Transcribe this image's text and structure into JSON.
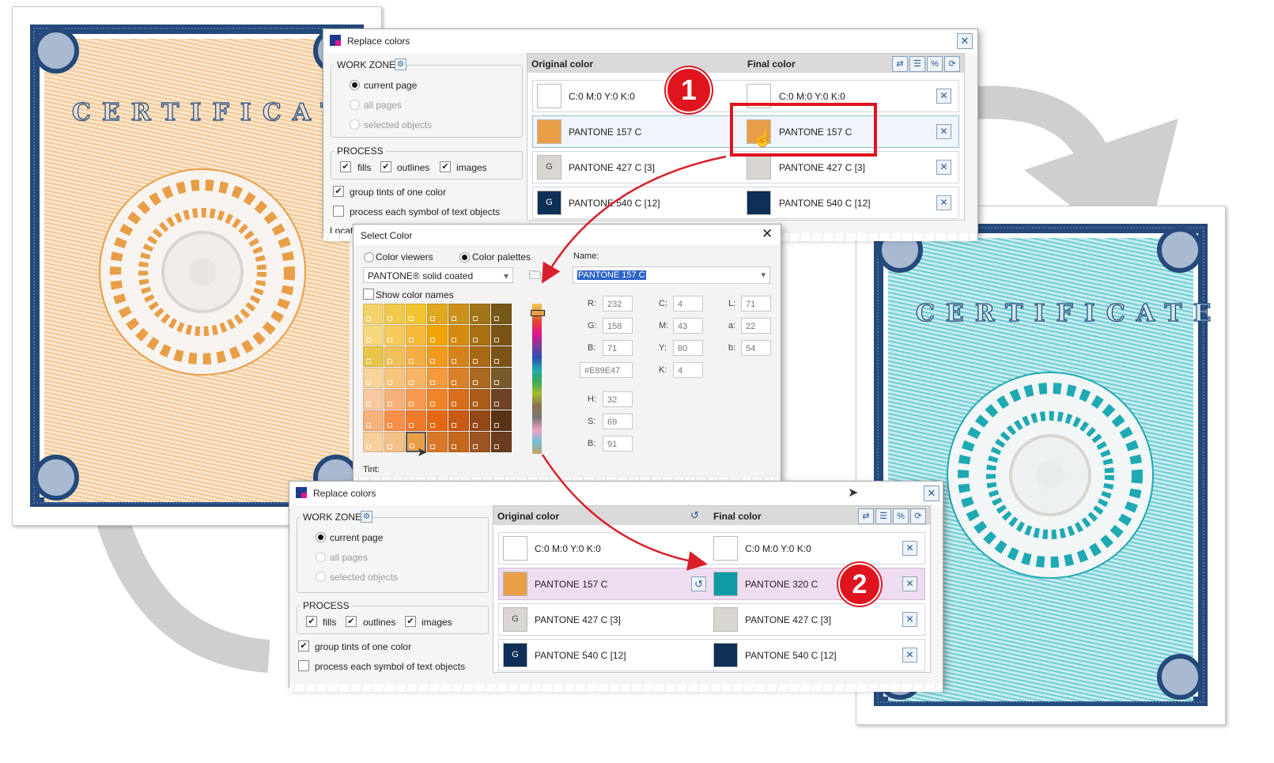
{
  "documents": {
    "left": {
      "title": "CERTIFICATE",
      "accent": "#e89e47"
    },
    "right": {
      "title": "CERTIFICATE",
      "accent": "#1fa9b3"
    }
  },
  "dialog1": {
    "title": "Replace colors",
    "work_zone": {
      "label": "WORK ZONE",
      "options": [
        "current page",
        "all pages",
        "selected objects"
      ]
    },
    "process": {
      "label": "PROCESS",
      "fills": "fills",
      "outlines": "outlines",
      "images": "images"
    },
    "group_tints": "group tints of one color",
    "process_symbols": "process each symbol of text objects",
    "truncated_label": "Locat",
    "headers": {
      "original": "Original color",
      "final": "Final color"
    },
    "rows": [
      {
        "orig_swatch": "#ffffff",
        "orig_letter": "",
        "orig": "C:0 M:0 Y:0 K:0",
        "final_swatch": "#ffffff",
        "final": "C:0 M:0 Y:0 K:0"
      },
      {
        "orig_swatch": "#e89e47",
        "orig_letter": "",
        "orig": "PANTONE 157 C",
        "final_swatch": "#e89e47",
        "final": "PANTONE 157 C"
      },
      {
        "orig_swatch": "#d9d6d1",
        "orig_letter": "G",
        "orig": "PANTONE 427 C [3]",
        "final_swatch": "#d9d6d1",
        "final": "PANTONE 427 C [3]"
      },
      {
        "orig_swatch": "#0e2f57",
        "orig_letter": "G",
        "orig": "PANTONE 540 C [12]",
        "final_swatch": "#0e2f57",
        "final": "PANTONE 540 C [12]"
      }
    ],
    "step_badge": "1"
  },
  "select_color": {
    "title": "Select Color",
    "mode_viewers": "Color viewers",
    "mode_palettes": "Color palettes",
    "palette_name": "PANTONE® solid coated",
    "show_names": "Show color names",
    "name_label": "Name:",
    "name_value": "PANTONE 157 C",
    "rgb": {
      "R": "232",
      "G": "158",
      "B": "71"
    },
    "cmyk": {
      "C": "4",
      "M": "43",
      "Y": "80",
      "K": "4"
    },
    "lab": {
      "L": "71",
      "a": "22",
      "b": "54"
    },
    "hex": "#E89E47",
    "hsb": {
      "H": "32",
      "S": "69",
      "B": "91"
    },
    "tint_label": "Tint:"
  },
  "dialog2": {
    "title": "Replace colors",
    "work_zone": {
      "label": "WORK ZONE",
      "options": [
        "current page",
        "all pages",
        "selected objects"
      ]
    },
    "process": {
      "label": "PROCESS",
      "fills": "fills",
      "outlines": "outlines",
      "images": "images"
    },
    "group_tints": "group tints of one color",
    "process_symbols": "process each symbol of text objects",
    "headers": {
      "original": "Original color",
      "final": "Final color"
    },
    "rows": [
      {
        "orig_swatch": "#ffffff",
        "orig_letter": "",
        "orig": "C:0 M:0 Y:0 K:0",
        "final_swatch": "#ffffff",
        "final": "C:0 M:0 Y:0 K:0"
      },
      {
        "orig_swatch": "#e89e47",
        "orig_letter": "",
        "orig": "PANTONE 157 C",
        "final_swatch": "#0e9ba6",
        "final": "PANTONE 320 C"
      },
      {
        "orig_swatch": "#d9d6d1",
        "orig_letter": "G",
        "orig": "PANTONE 427 C [3]",
        "final_swatch": "#d9d6d1",
        "final": "PANTONE 427 C [3]"
      },
      {
        "orig_swatch": "#0e2f57",
        "orig_letter": "G",
        "orig": "PANTONE 540 C [12]",
        "final_swatch": "#0e2f57",
        "final": "PANTONE 540 C [12]"
      }
    ],
    "step_badge": "2"
  },
  "colors": {
    "highlight_red": "#e0141e",
    "arrow_red": "#d9202a",
    "navy": "#24497a"
  }
}
